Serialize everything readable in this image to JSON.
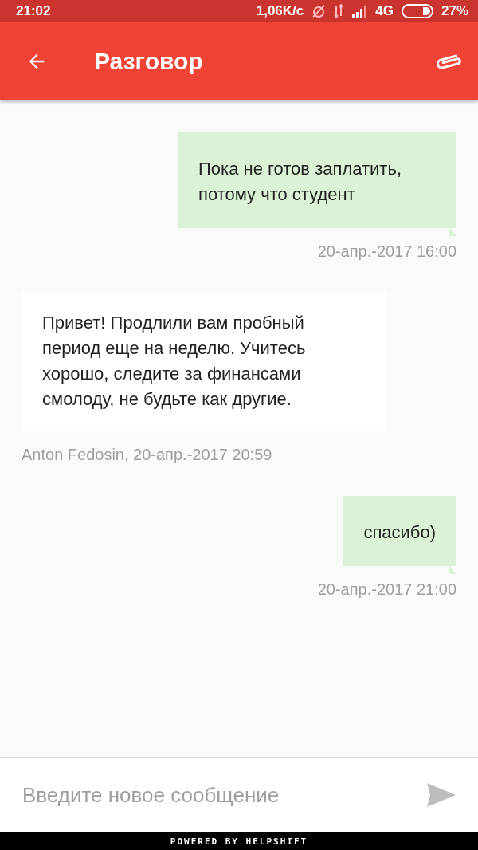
{
  "status_bar": {
    "time": "21:02",
    "speed": "1,06K/c",
    "network": "4G",
    "battery": "27%"
  },
  "app_bar": {
    "title": "Разговор"
  },
  "messages": [
    {
      "kind": "outgoing",
      "text": "Пока не готов заплатить, потому что студент",
      "meta": "20-апр.-2017 16:00"
    },
    {
      "kind": "incoming",
      "text": "Привет! Продлили вам пробный период еще на неделю. Учитесь хорошо, следите за финансами смолоду, не будьте как другие.",
      "meta": "Anton Fedosin, 20-апр.-2017 20:59"
    },
    {
      "kind": "outgoing",
      "text": "спасибо)",
      "meta": "20-апр.-2017 21:00"
    }
  ],
  "composer": {
    "placeholder": "Введите новое сообщение"
  },
  "footer": "POWERED BY HELPSHIFT"
}
